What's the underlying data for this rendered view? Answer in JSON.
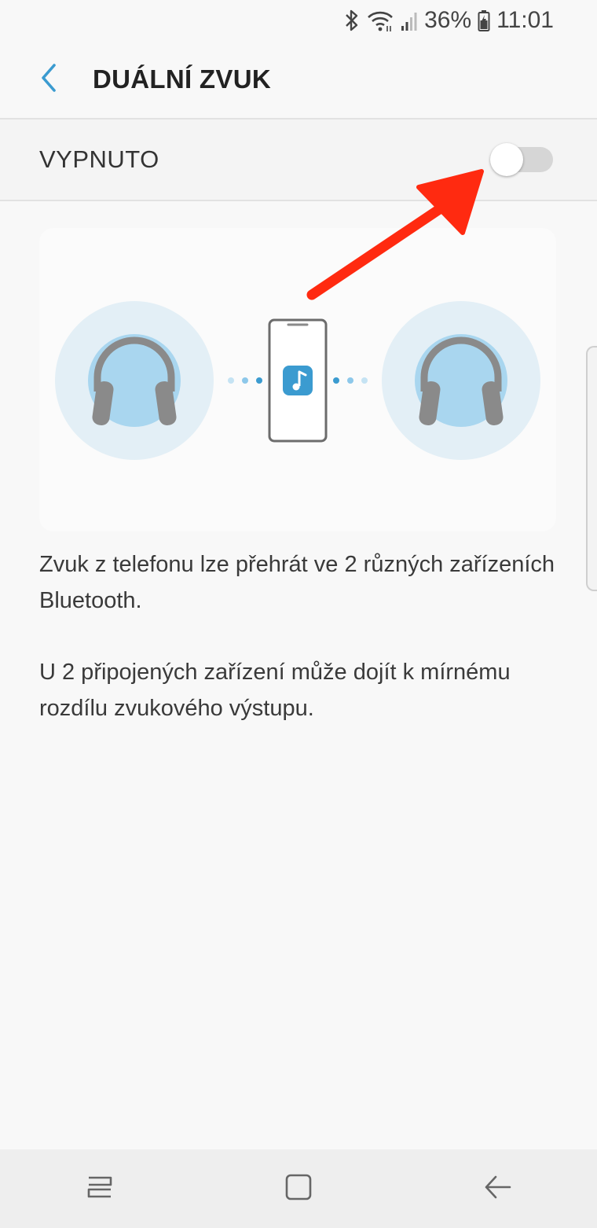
{
  "status_bar": {
    "battery": "36%",
    "time": "11:01",
    "icons": [
      "bluetooth-icon",
      "wifi-icon",
      "signal-icon",
      "battery-icon"
    ]
  },
  "app_bar": {
    "back_icon": "chevron-left-icon",
    "title": "DUÁLNÍ ZVUK"
  },
  "toggle": {
    "label": "VYPNUTO",
    "state": false
  },
  "illustration": {
    "icons": [
      "headphones-icon",
      "phone-icon",
      "music-note-icon",
      "headphones-icon"
    ]
  },
  "description": {
    "paragraph1": "Zvuk z telefonu lze přehrát ve 2 různých zařízeních Bluetooth.",
    "paragraph2": "U 2 připojených zařízení může dojít k mírnému rozdílu zvukového výstupu."
  },
  "nav_bar": {
    "icons": [
      "recent-apps-icon",
      "home-icon",
      "back-icon"
    ]
  },
  "colors": {
    "accent": "#3b9bd0",
    "annotation": "#ff2a10",
    "halo_outer": "#e3eff6",
    "halo_inner": "#a9d6ef",
    "headphone": "#8a8a8a"
  }
}
